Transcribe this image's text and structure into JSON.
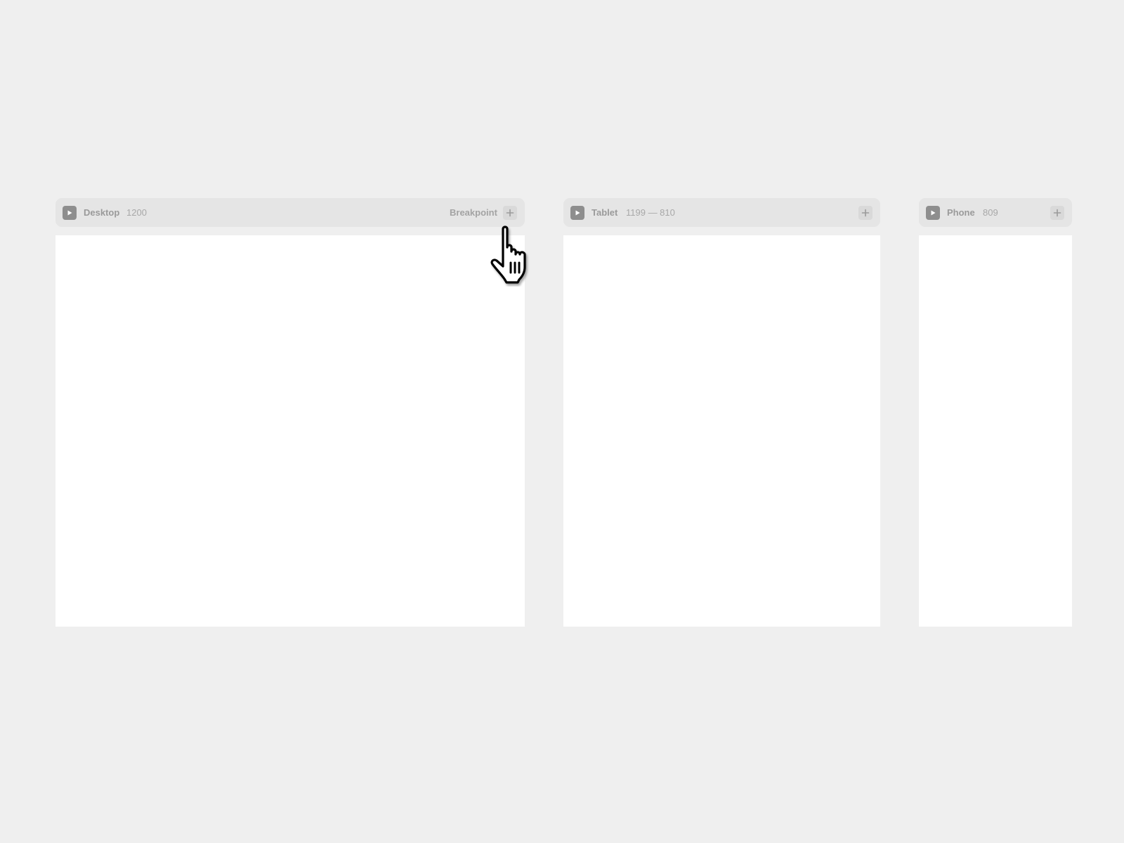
{
  "frames": [
    {
      "name": "Desktop",
      "size": "1200",
      "breakpoint_label": "Breakpoint",
      "play_icon": "play-icon",
      "add_icon": "plus-icon"
    },
    {
      "name": "Tablet",
      "size": "1199 — 810",
      "play_icon": "play-icon",
      "add_icon": "plus-icon"
    },
    {
      "name": "Phone",
      "size": "809",
      "play_icon": "play-icon",
      "add_icon": "plus-icon"
    }
  ],
  "cursor": {
    "icon": "hand-pointer-cursor-icon"
  },
  "colors": {
    "background": "#efefef",
    "header": "#e5e5e5",
    "canvas": "#ffffff",
    "icon": "#8e8e8e"
  }
}
